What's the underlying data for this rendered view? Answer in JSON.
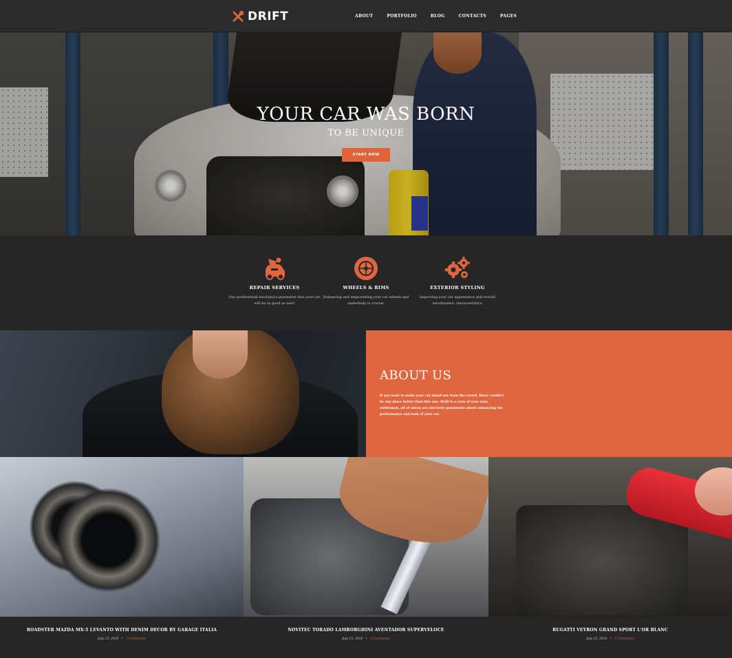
{
  "header": {
    "logo_text": "DRIFT",
    "nav": [
      "ABOUT",
      "PORTFOLIO",
      "BLOG",
      "CONTACTS",
      "PAGES"
    ]
  },
  "hero": {
    "title": "YOUR CAR WAS BORN",
    "subtitle": "TO BE UNIQUE",
    "cta_label": "START NOW"
  },
  "services": [
    {
      "icon": "mechanic-car-icon",
      "title": "REPAIR SERVICES",
      "desc": "Our professional mechanics guarantee that your car will be as good as new!"
    },
    {
      "icon": "wheel-icon",
      "title": "WHEELS & RIMS",
      "desc": "Enhancing and empowering your car wheels and underbody is crucial."
    },
    {
      "icon": "gears-icon",
      "title": "EXTERIOR STYLING",
      "desc": "Improving your car appearance and overall aerodynamic characteristics."
    }
  ],
  "about": {
    "title": "ABOUT US",
    "text": "If you want to make your car stand out from the crowd, there couldn't be any place better than this one. Drift is a crew of true auto enthusiast, all of whom are sincerely passionate about enhancing the performance and look of your car."
  },
  "posts": [
    {
      "title": "ROADSTER MAZDA MX-5 LEVANTO WITH DENIM DECOR BY GARAGE ITALIA",
      "date": "July 15, 2016",
      "comments": "3 Comments"
    },
    {
      "title": "NOVITEC TORADO LAMBORGHINI AVENTADOR SUPERVELOCE",
      "date": "July 15, 2016",
      "comments": "3 Comments"
    },
    {
      "title": "BUGATTI VEYRON GRAND SPORT L'OR BLANC",
      "date": "July 15, 2016",
      "comments": "3 Comments"
    }
  ],
  "colors": {
    "accent": "#e0663f",
    "background": "#262626"
  }
}
